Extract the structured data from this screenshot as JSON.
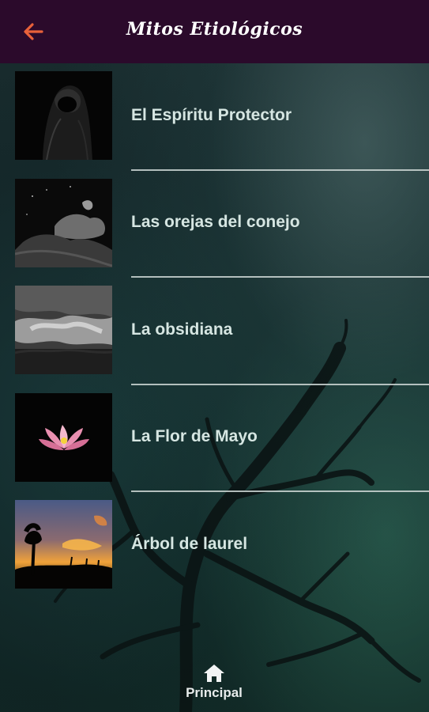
{
  "app_bar": {
    "title": "Mitos Etiológicos",
    "back_icon": "arrow-left-icon",
    "back_color": "#e8613a",
    "background": "#2b0a2b"
  },
  "items": [
    {
      "label": "El Espíritu Protector",
      "thumb": "hooded-figure-image"
    },
    {
      "label": "Las orejas del conejo",
      "thumb": "moon-clouds-image"
    },
    {
      "label": "La obsidiana",
      "thumb": "storm-clouds-image"
    },
    {
      "label": "La Flor de Mayo",
      "thumb": "lotus-flower-image"
    },
    {
      "label": "Árbol de laurel",
      "thumb": "sunset-tree-image"
    }
  ],
  "bottom_nav": {
    "label": "Principal",
    "icon": "home-icon"
  }
}
